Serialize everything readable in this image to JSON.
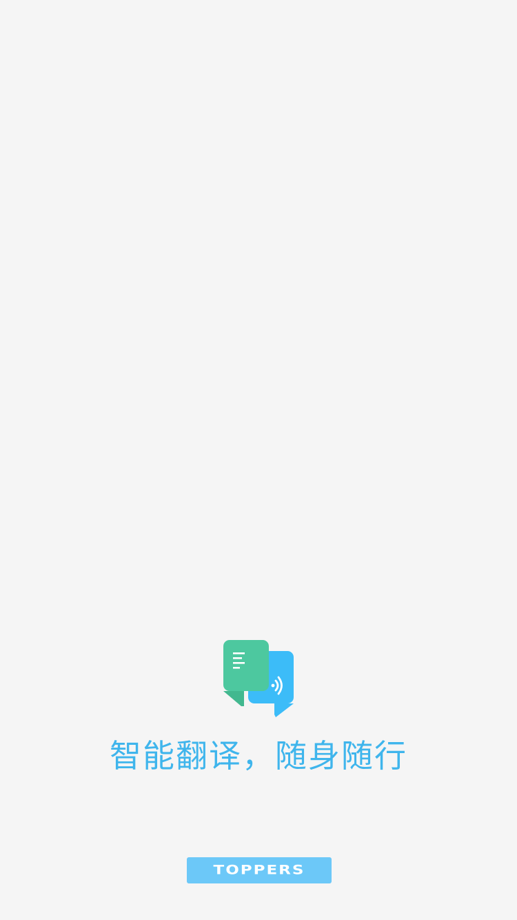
{
  "splash": {
    "logo_icon": "translate-chat-bubbles-icon",
    "slogan": "智能翻译，随身随行",
    "brand": "TOPPERS"
  },
  "colors": {
    "background": "#f5f5f5",
    "accent_blue": "#3fb5ec",
    "bubble_green": "#4dc89f",
    "bubble_blue": "#3cbcf8",
    "badge_blue": "#6cc8f8"
  }
}
